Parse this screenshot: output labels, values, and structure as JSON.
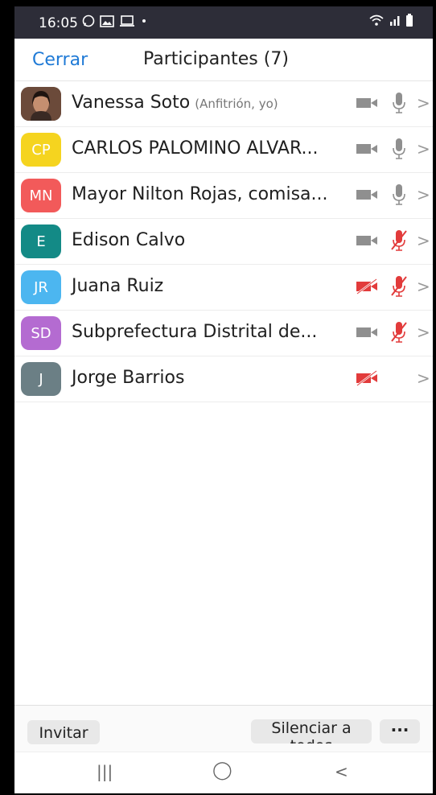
{
  "status": {
    "time": "16:05"
  },
  "header": {
    "close": "Cerrar",
    "title": "Participantes (7)"
  },
  "participants": [
    {
      "initials": "",
      "name": "Vanessa Soto",
      "role": "(Anfitrión, yo)",
      "avatar_color": "#5a3c30",
      "video_muted": false,
      "mic_muted": false,
      "mic_visible": true
    },
    {
      "initials": "CP",
      "name": "CARLOS PALOMINO ALVAR...",
      "role": "",
      "avatar_color": "#f5d41f",
      "video_muted": false,
      "mic_muted": false,
      "mic_visible": true
    },
    {
      "initials": "MN",
      "name": "Mayor Nilton Rojas, comisa...",
      "role": "",
      "avatar_color": "#f25a5a",
      "video_muted": false,
      "mic_muted": false,
      "mic_visible": true
    },
    {
      "initials": "E",
      "name": "Edison Calvo",
      "role": "",
      "avatar_color": "#138a86",
      "video_muted": false,
      "mic_muted": true,
      "mic_visible": true
    },
    {
      "initials": "JR",
      "name": "Juana Ruiz",
      "role": "",
      "avatar_color": "#4cb6f0",
      "video_muted": true,
      "mic_muted": true,
      "mic_visible": true
    },
    {
      "initials": "SD",
      "name": "Subprefectura Distrital de...",
      "role": "",
      "avatar_color": "#b46bd1",
      "video_muted": false,
      "mic_muted": true,
      "mic_visible": true
    },
    {
      "initials": "J",
      "name": "Jorge Barrios",
      "role": "",
      "avatar_color": "#6b7f85",
      "video_muted": true,
      "mic_muted": false,
      "mic_visible": false
    }
  ],
  "footer": {
    "invite": "Invitar",
    "mute_all": "Silenciar a todos",
    "more": "···"
  },
  "nav": {
    "recents": "|||",
    "home": "◯",
    "back": "<"
  },
  "colors": {
    "accent": "#1f7ad6",
    "muted_red": "#e23b3b",
    "icon_gray": "#8f8f8f"
  }
}
